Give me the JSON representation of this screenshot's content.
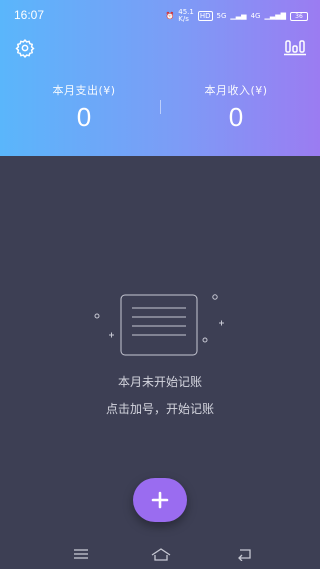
{
  "status_bar": {
    "time": "16:07",
    "icons": [
      "alarm-icon",
      "network-speed-icon",
      "hd-icon",
      "5g-signal-icon",
      "4g-signal-icon",
      "battery-icon"
    ],
    "speed": "45.1\nK/s",
    "network_label": "5G",
    "network_label_2": "4G",
    "battery": "36"
  },
  "header": {
    "settings_icon": "gear-icon",
    "chart_icon": "bar-chart-icon",
    "expense_label": "本月支出(¥)",
    "expense_value": "0",
    "income_label": "本月收入(¥)",
    "income_value": "0",
    "gradient": [
      "#5ab6fb",
      "#9b7cf2"
    ]
  },
  "empty_state": {
    "icon": "ledger-icon",
    "title": "本月未开始记账",
    "hint": "点击加号，开始记账"
  },
  "fab": {
    "icon": "plus-icon",
    "color": "#9a6cf0"
  },
  "nav": {
    "items": [
      "menu-icon",
      "home-icon",
      "back-icon"
    ]
  },
  "colors": {
    "background": "#3d3f54",
    "text_muted": "#d4d5de"
  }
}
